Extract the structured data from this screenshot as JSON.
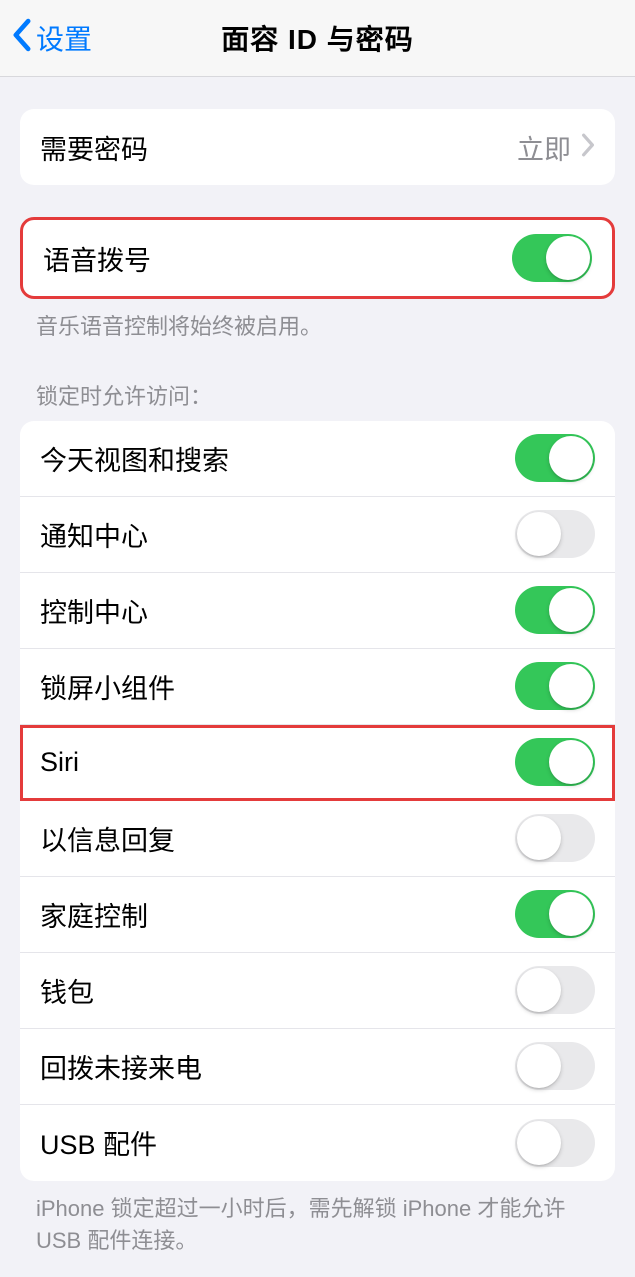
{
  "nav": {
    "back_label": "设置",
    "title": "面容 ID 与密码"
  },
  "passcode_row": {
    "label": "需要密码",
    "value": "立即"
  },
  "voice_dial": {
    "label": "语音拨号",
    "on": true,
    "footer": "音乐语音控制将始终被启用。"
  },
  "lock_access": {
    "header": "锁定时允许访问：",
    "items": [
      {
        "label": "今天视图和搜索",
        "on": true
      },
      {
        "label": "通知中心",
        "on": false
      },
      {
        "label": "控制中心",
        "on": true
      },
      {
        "label": "锁屏小组件",
        "on": true
      },
      {
        "label": "Siri",
        "on": true
      },
      {
        "label": "以信息回复",
        "on": false
      },
      {
        "label": "家庭控制",
        "on": true
      },
      {
        "label": "钱包",
        "on": false
      },
      {
        "label": "回拨未接来电",
        "on": false
      },
      {
        "label": "USB 配件",
        "on": false
      }
    ],
    "footer": "iPhone 锁定超过一小时后，需先解锁 iPhone 才能允许 USB 配件连接。"
  }
}
